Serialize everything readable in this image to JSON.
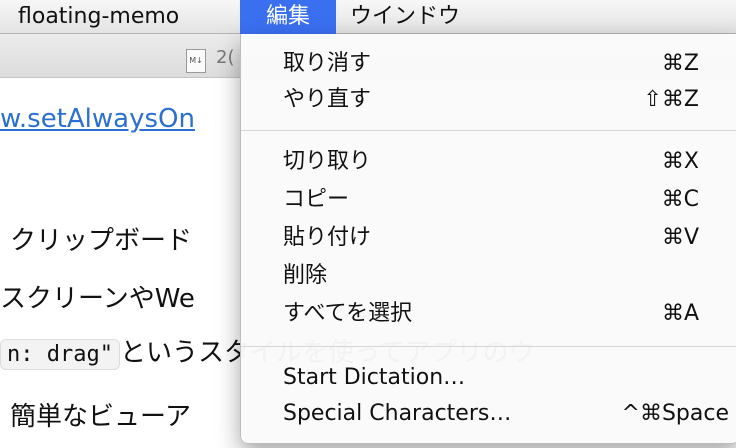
{
  "menubar": {
    "app_name": "floating-memo",
    "edit_menu": "編集",
    "window_menu": "ウインドウ"
  },
  "document": {
    "title_fragment": "2(",
    "link_text": "w.setAlwaysOn",
    "line1": "クリップボード",
    "line2": "スクリーンやWe",
    "line3_code": "n: drag\"",
    "line3_text": "というスタイルを使ってアプリのウ",
    "line4": "簡単なビューア"
  },
  "edit_menu": {
    "items": [
      {
        "label": "取り消す",
        "shortcut": "⌘Z"
      },
      {
        "label": "やり直す",
        "shortcut": "⇧⌘Z"
      },
      {
        "label": "切り取り",
        "shortcut": "⌘X"
      },
      {
        "label": "コピー",
        "shortcut": "⌘C"
      },
      {
        "label": "貼り付け",
        "shortcut": "⌘V"
      },
      {
        "label": "削除",
        "shortcut": ""
      },
      {
        "label": "すべてを選択",
        "shortcut": "⌘A"
      },
      {
        "label": "Start Dictation…",
        "shortcut": ""
      },
      {
        "label": "Special Characters…",
        "shortcut": "^⌘Space"
      }
    ]
  },
  "colors": {
    "menu_highlight": "#3a6ff0",
    "link": "#2b6fd1"
  }
}
